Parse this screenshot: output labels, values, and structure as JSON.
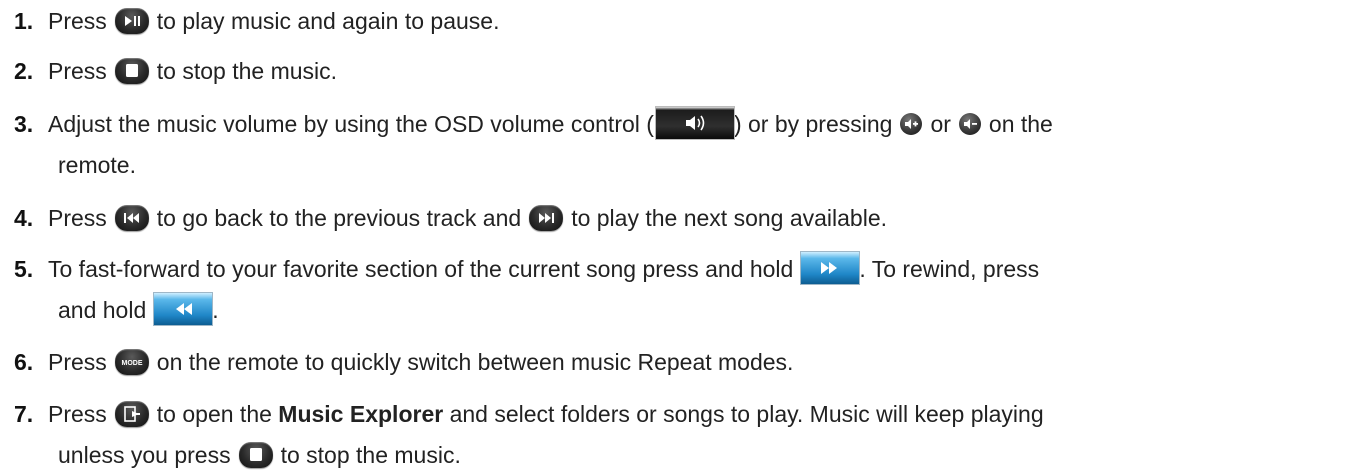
{
  "items": [
    {
      "number": "1.",
      "before": "Press",
      "after": "to play music and again to pause."
    },
    {
      "number": "2.",
      "before": "Press",
      "after": "to stop the music."
    },
    {
      "number": "3.",
      "before": "Adjust the music volume by using the OSD volume control (",
      "middle1": ") or by pressing",
      "middle2": "or",
      "after": "on the",
      "continuation": "remote."
    },
    {
      "number": "4.",
      "before": "Press",
      "middle1": "to go back to the previous track and",
      "after": "to play the next song available."
    },
    {
      "number": "5.",
      "before": "To fast-forward to your favorite section of the current song press and hold",
      "after": ". To rewind, press",
      "continuation_before": "and hold",
      "continuation_after": "."
    },
    {
      "number": "6.",
      "before": "Press",
      "after": "on the remote to quickly switch between music Repeat modes."
    },
    {
      "number": "7.",
      "before": "Press",
      "middle1": "to open the",
      "bold": "Music Explorer",
      "after": "and select folders or songs to play. Music will keep playing",
      "continuation_before": "unless you press",
      "continuation_after": "to stop the music."
    }
  ],
  "icons": {
    "mode_label": "MODE"
  }
}
